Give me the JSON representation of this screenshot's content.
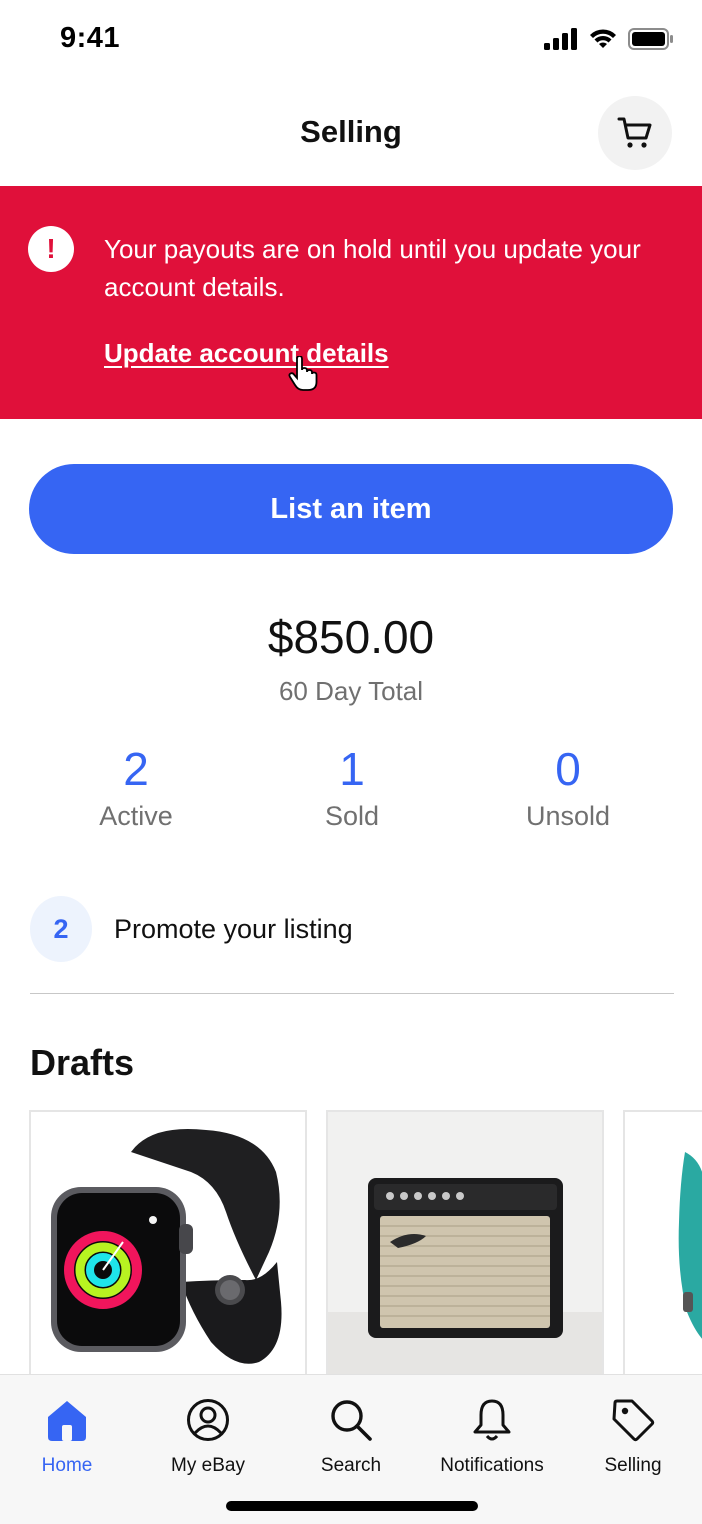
{
  "status_bar": {
    "time": "9:41"
  },
  "header": {
    "title": "Selling",
    "cart_icon": "cart-icon"
  },
  "alert": {
    "icon": "exclamation-icon",
    "message": "Your payouts are on hold until you update your account details.",
    "link_label": "Update account details",
    "background_color": "#e0103a"
  },
  "cta": {
    "label": "List an item",
    "color": "#3665f3"
  },
  "summary": {
    "amount": "$850.00",
    "label": "60 Day Total",
    "stats": [
      {
        "value": "2",
        "label": "Active"
      },
      {
        "value": "1",
        "label": "Sold"
      },
      {
        "value": "0",
        "label": "Unsold"
      }
    ]
  },
  "promote": {
    "count": "2",
    "label": "Promote your listing"
  },
  "drafts": {
    "title": "Drafts",
    "items": [
      {
        "icon": "smartwatch-image"
      },
      {
        "icon": "guitar-amplifier-image"
      },
      {
        "icon": "teal-item-image"
      }
    ]
  },
  "tabbar": {
    "tabs": [
      {
        "label": "Home",
        "icon": "home-icon",
        "active": true
      },
      {
        "label": "My eBay",
        "icon": "user-circle-icon",
        "active": false
      },
      {
        "label": "Search",
        "icon": "search-icon",
        "active": false
      },
      {
        "label": "Notifications",
        "icon": "bell-icon",
        "active": false
      },
      {
        "label": "Selling",
        "icon": "tag-icon",
        "active": false
      }
    ],
    "active_color": "#3665f3"
  }
}
